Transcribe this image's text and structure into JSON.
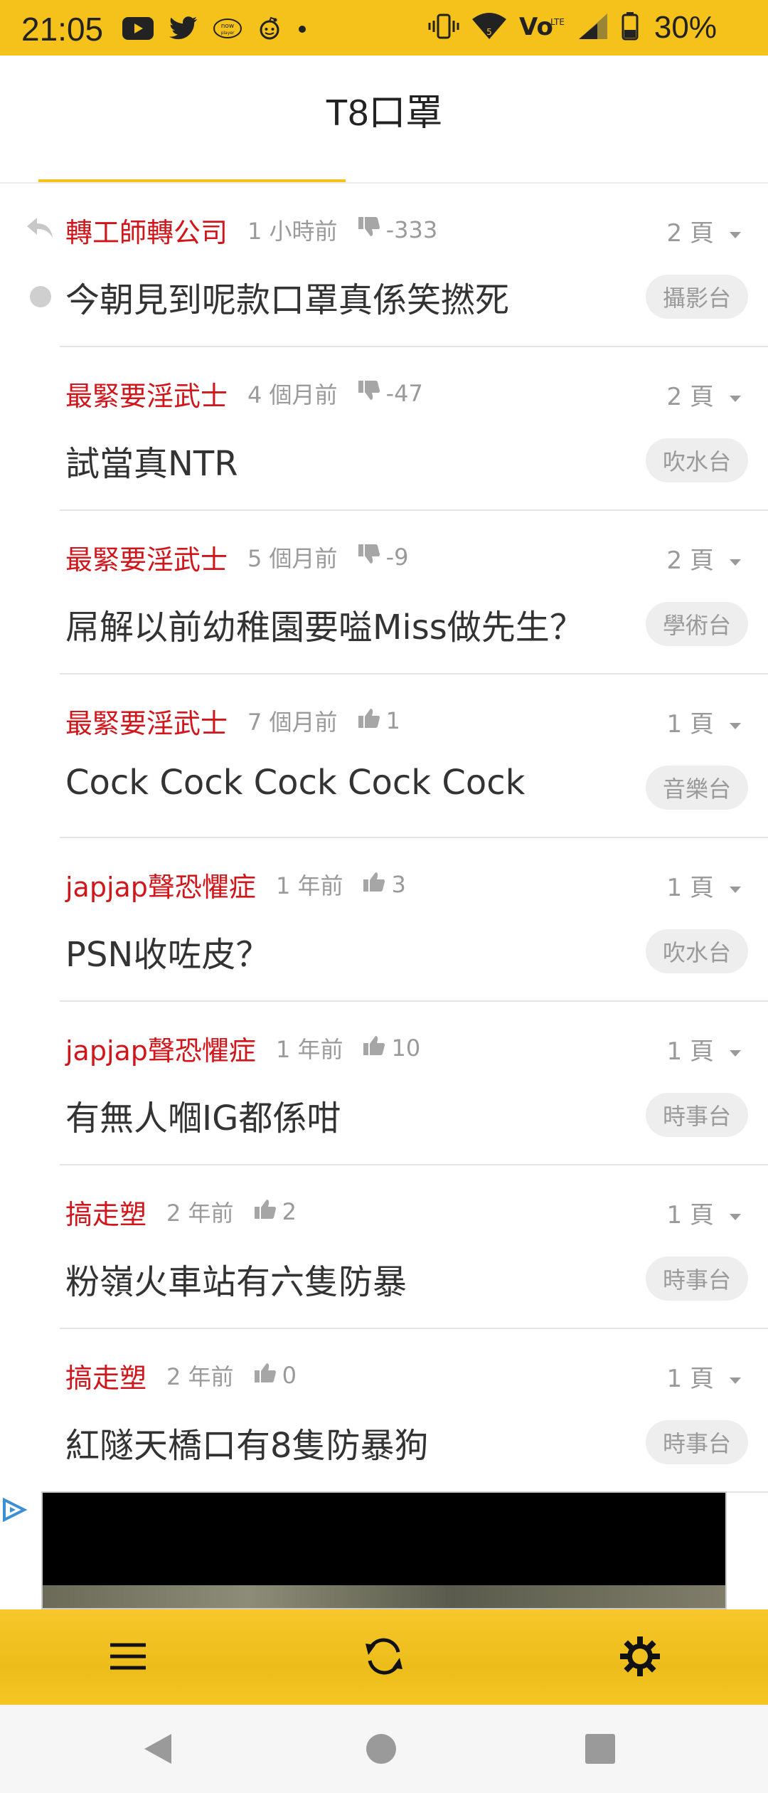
{
  "status_bar": {
    "time": "21:05",
    "battery": "30%",
    "left_icons": [
      "youtube-icon",
      "twitter-icon",
      "nowtv-player-icon",
      "reddit-icon",
      "dot-icon"
    ],
    "right_icons": [
      "vibrate-icon",
      "wifi-icon",
      "volte-icon",
      "signal-icon",
      "battery-icon"
    ]
  },
  "header": {
    "title": "T8口罩"
  },
  "colors": {
    "accent": "#f5c21b",
    "author": "#d0161b",
    "muted": "#9a9a9a",
    "tag_bg": "#eeeeee"
  },
  "threads": [
    {
      "author": "轉工師轉公司",
      "time": "1 小時前",
      "rating_type": "down",
      "rating": "-333",
      "pages": "2 頁",
      "title": "今朝見到呢款口罩真係笑撚死",
      "forum": "攝影台",
      "is_reply": true,
      "unread": true
    },
    {
      "author": "最緊要淫武士",
      "time": "4 個月前",
      "rating_type": "down",
      "rating": "-47",
      "pages": "2 頁",
      "title": "試當真NTR",
      "forum": "吹水台"
    },
    {
      "author": "最緊要淫武士",
      "time": "5 個月前",
      "rating_type": "down",
      "rating": "-9",
      "pages": "2 頁",
      "title": "屌解以前幼稚園要嗌Miss做先生？",
      "forum": "學術台"
    },
    {
      "author": "最緊要淫武士",
      "time": "7 個月前",
      "rating_type": "up",
      "rating": "1",
      "pages": "1 頁",
      "title": "Cock Cock Cock Cock Cock",
      "forum": "音樂台"
    },
    {
      "author": "japjap聲恐懼症",
      "time": "1 年前",
      "rating_type": "up",
      "rating": "3",
      "pages": "1 頁",
      "title": "PSN收咗皮？",
      "forum": "吹水台"
    },
    {
      "author": "japjap聲恐懼症",
      "time": "1 年前",
      "rating_type": "up",
      "rating": "10",
      "pages": "1 頁",
      "title": "有無人嗰IG都係咁",
      "forum": "時事台"
    },
    {
      "author": "搞走塑",
      "time": "2 年前",
      "rating_type": "up",
      "rating": "2",
      "pages": "1 頁",
      "title": "粉嶺火車站有六隻防暴",
      "forum": "時事台"
    },
    {
      "author": "搞走塑",
      "time": "2 年前",
      "rating_type": "up",
      "rating": "0",
      "pages": "1 頁",
      "title": "紅隧天橋口有8隻防暴狗",
      "forum": "時事台"
    }
  ],
  "toolbar": {
    "buttons": [
      "menu-icon",
      "refresh-icon",
      "settings-icon"
    ]
  },
  "nav": {
    "buttons": [
      "back-icon",
      "home-icon",
      "recents-icon"
    ]
  }
}
